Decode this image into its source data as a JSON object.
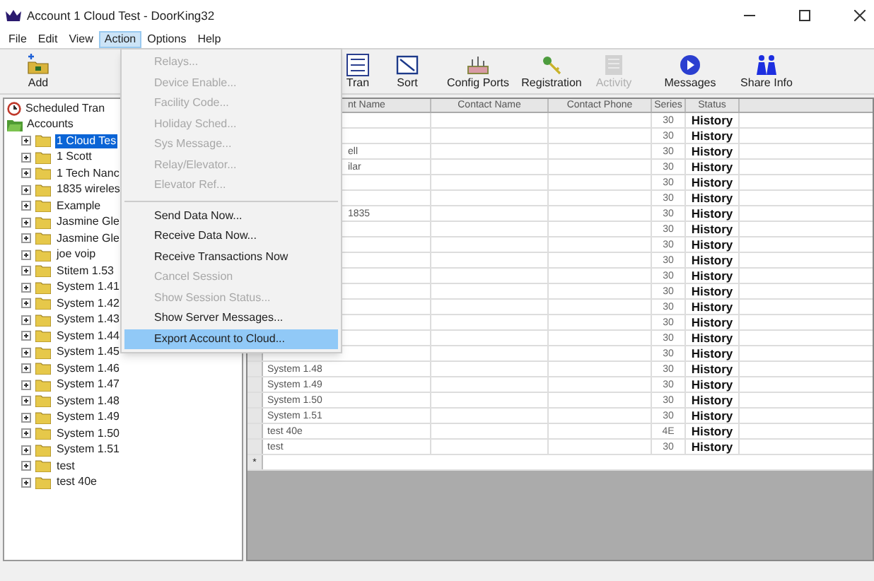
{
  "window": {
    "title": "Account 1 Cloud Test - DoorKing32"
  },
  "menu_bar": [
    {
      "label": "File",
      "selected": false
    },
    {
      "label": "Edit",
      "selected": false
    },
    {
      "label": "View",
      "selected": false
    },
    {
      "label": "Action",
      "selected": true
    },
    {
      "label": "Options",
      "selected": false
    },
    {
      "label": "Help",
      "selected": false
    }
  ],
  "toolbar": [
    {
      "label": "Add",
      "disabled": false
    },
    {
      "label": "Tran",
      "disabled": false
    },
    {
      "label": "Sort",
      "disabled": false
    },
    {
      "label": "Config Ports",
      "disabled": false
    },
    {
      "label": "Registration",
      "disabled": false
    },
    {
      "label": "Activity",
      "disabled": true
    },
    {
      "label": "Messages",
      "disabled": false
    },
    {
      "label": "Share Info",
      "disabled": false
    }
  ],
  "tree": [
    {
      "label": "Scheduled Tran",
      "kind": "clock"
    },
    {
      "label": "Accounts",
      "kind": "root",
      "children": [
        {
          "label": "1 Cloud Tes",
          "selected": true
        },
        {
          "label": "1 Scott",
          "selected": false
        },
        {
          "label": "1 Tech Nanc",
          "selected": false
        },
        {
          "label": "1835 wireles",
          "selected": false
        },
        {
          "label": "Example",
          "selected": false
        },
        {
          "label": "Jasmine Gle",
          "selected": false
        },
        {
          "label": "Jasmine Gle",
          "selected": false
        },
        {
          "label": "joe voip",
          "selected": false
        },
        {
          "label": "Stitem 1.53",
          "selected": false
        },
        {
          "label": "System 1.41",
          "selected": false
        },
        {
          "label": "System 1.42",
          "selected": false
        },
        {
          "label": "System 1.43",
          "selected": false
        },
        {
          "label": "System 1.44",
          "selected": false
        },
        {
          "label": "System 1.45",
          "selected": false
        },
        {
          "label": "System 1.46",
          "selected": false
        },
        {
          "label": "System 1.47",
          "selected": false
        },
        {
          "label": "System 1.48",
          "selected": false
        },
        {
          "label": "System 1.49",
          "selected": false
        },
        {
          "label": "System 1.50",
          "selected": false
        },
        {
          "label": "System 1.51",
          "selected": false
        },
        {
          "label": "test",
          "selected": false
        },
        {
          "label": "test 40e",
          "selected": false
        }
      ]
    }
  ],
  "action_menu": [
    {
      "label": "Relays...",
      "disabled": true,
      "selected": false
    },
    {
      "label": "Device Enable...",
      "disabled": true,
      "selected": false
    },
    {
      "label": "Facility Code...",
      "disabled": true,
      "selected": false
    },
    {
      "label": "Holiday Sched...",
      "disabled": true,
      "selected": false
    },
    {
      "label": "Sys Message...",
      "disabled": true,
      "selected": false
    },
    {
      "label": "Relay/Elevator...",
      "disabled": true,
      "selected": false
    },
    {
      "label": "Elevator Ref...",
      "disabled": true,
      "selected": false,
      "separator_after": true
    },
    {
      "label": "Send Data Now...",
      "disabled": false,
      "selected": false
    },
    {
      "label": "Receive Data Now...",
      "disabled": false,
      "selected": false
    },
    {
      "label": "Receive Transactions Now",
      "disabled": false,
      "selected": false
    },
    {
      "label": "Cancel Session",
      "disabled": true,
      "selected": false
    },
    {
      "label": "Show Session Status...",
      "disabled": true,
      "selected": false
    },
    {
      "label": "Show Server Messages...",
      "disabled": false,
      "selected": false
    },
    {
      "label": "Export Account to Cloud...",
      "disabled": false,
      "selected": true
    }
  ],
  "table": {
    "columns": [
      "nt Name",
      "Contact Name",
      "Contact Phone",
      "Series",
      "Status"
    ],
    "rows": [
      {
        "name": "",
        "series": "30",
        "status": "History"
      },
      {
        "name": "",
        "series": "30",
        "status": "History"
      },
      {
        "name": "ell",
        "series": "30",
        "status": "History"
      },
      {
        "name": "ilar",
        "series": "30",
        "status": "History"
      },
      {
        "name": "",
        "series": "30",
        "status": "History"
      },
      {
        "name": "",
        "series": "30",
        "status": "History"
      },
      {
        "name": "1835",
        "series": "30",
        "status": "History"
      },
      {
        "name": "",
        "series": "30",
        "status": "History"
      },
      {
        "name": "",
        "series": "30",
        "status": "History"
      },
      {
        "name": "",
        "series": "30",
        "status": "History"
      },
      {
        "name": "",
        "series": "30",
        "status": "History"
      },
      {
        "name": "",
        "series": "30",
        "status": "History"
      },
      {
        "name": "",
        "series": "30",
        "status": "History"
      },
      {
        "name": "",
        "series": "30",
        "status": "History"
      },
      {
        "name": "",
        "series": "30",
        "status": "History"
      },
      {
        "name": "",
        "series": "30",
        "status": "History"
      },
      {
        "name": "System 1.48",
        "series": "30",
        "status": "History"
      },
      {
        "name": "System 1.49",
        "series": "30",
        "status": "History"
      },
      {
        "name": "System 1.50",
        "series": "30",
        "status": "History"
      },
      {
        "name": "System 1.51",
        "series": "30",
        "status": "History"
      },
      {
        "name": "test 40e",
        "series": "4E",
        "status": "History"
      },
      {
        "name": "test",
        "series": "30",
        "status": "History"
      }
    ],
    "new_row_marker": "*"
  }
}
